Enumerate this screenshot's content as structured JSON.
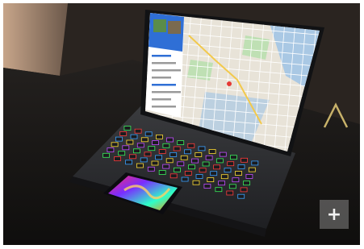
{
  "scene": {
    "subject": "laptop-with-map-display-and-touchscreen-trackpad",
    "colors": {
      "wall_left": "#c9a98e",
      "wall_dark": "#2a2420",
      "table": "#1c1a19",
      "laptop_body": "#2d2e31",
      "screen_bezel": "#111214",
      "map_base": "#e8e3d8",
      "map_water": "#a9c8e4",
      "map_park": "#bfe0b4",
      "map_road": "#f2c94c",
      "sidebar_blue": "#2f6fd6",
      "keyboard_glow": [
        "#3af05a",
        "#ff3b3b",
        "#3aa0ff",
        "#ffdd33",
        "#c24dff"
      ],
      "pad_colors": [
        "#ff2d6b",
        "#7a2cff",
        "#2dffc8",
        "#ff8a00"
      ],
      "logo_accent": "#c8b26a"
    }
  },
  "watermark": {
    "icon": "digital-trends-plus-icon",
    "text": "+"
  }
}
